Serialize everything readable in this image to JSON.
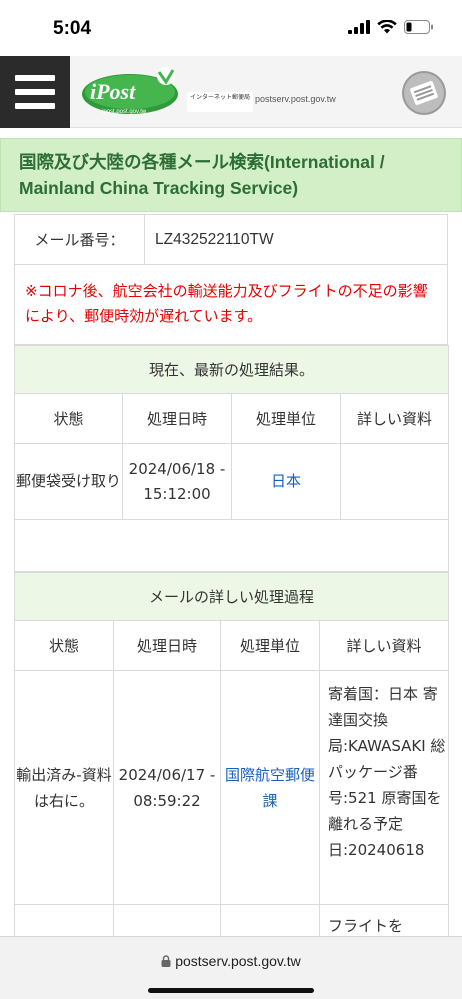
{
  "status_bar": {
    "time": "5:04"
  },
  "header": {
    "logo_text": "iPost",
    "logo_sub": "ipost.post.gov.tw",
    "caption": "インターネット郵便局",
    "url": "postserv.post.gov.tw"
  },
  "title": "国際及び大陸の各種メール検索(International / Mainland China Tracking Service)",
  "mail": {
    "label": "メール番号：",
    "value": "LZ432522110TW"
  },
  "notice": "※コロナ後、航空会社の輸送能力及びフライトの不足の影響により、郵便時効が遅れています。",
  "latest": {
    "heading": "現在、最新の処理結果。",
    "columns": [
      "状態",
      "処理日時",
      "処理単位",
      "詳しい資料"
    ],
    "row": {
      "status": "郵便袋受け取り",
      "datetime": "2024/06/18 - 15:12:00",
      "unit": "日本",
      "detail": ""
    }
  },
  "history": {
    "heading": "メールの詳しい処理過程",
    "columns": [
      "状態",
      "処理日時",
      "処理単位",
      "詳しい資料"
    ],
    "rows": [
      {
        "status": "輸出済み-資料は右に。",
        "datetime": "2024/06/17 - 08:59:22",
        "unit": "国際航空郵便課",
        "detail": "寄着国：日本 寄達国交換局:KAWASAKI 総パッケージ番号:521 原寄国を離れる予定日:20240618"
      },
      {
        "status": "",
        "datetime": "",
        "unit": "",
        "detail": "フライトを"
      }
    ]
  },
  "url_bar": {
    "url": "postserv.post.gov.tw"
  },
  "colors": {
    "title_bg": "#d3efc7",
    "title_text": "#2d6e36",
    "notice": "#e60000",
    "link": "#1a5fbd",
    "section_bg": "#ecf7e6"
  }
}
